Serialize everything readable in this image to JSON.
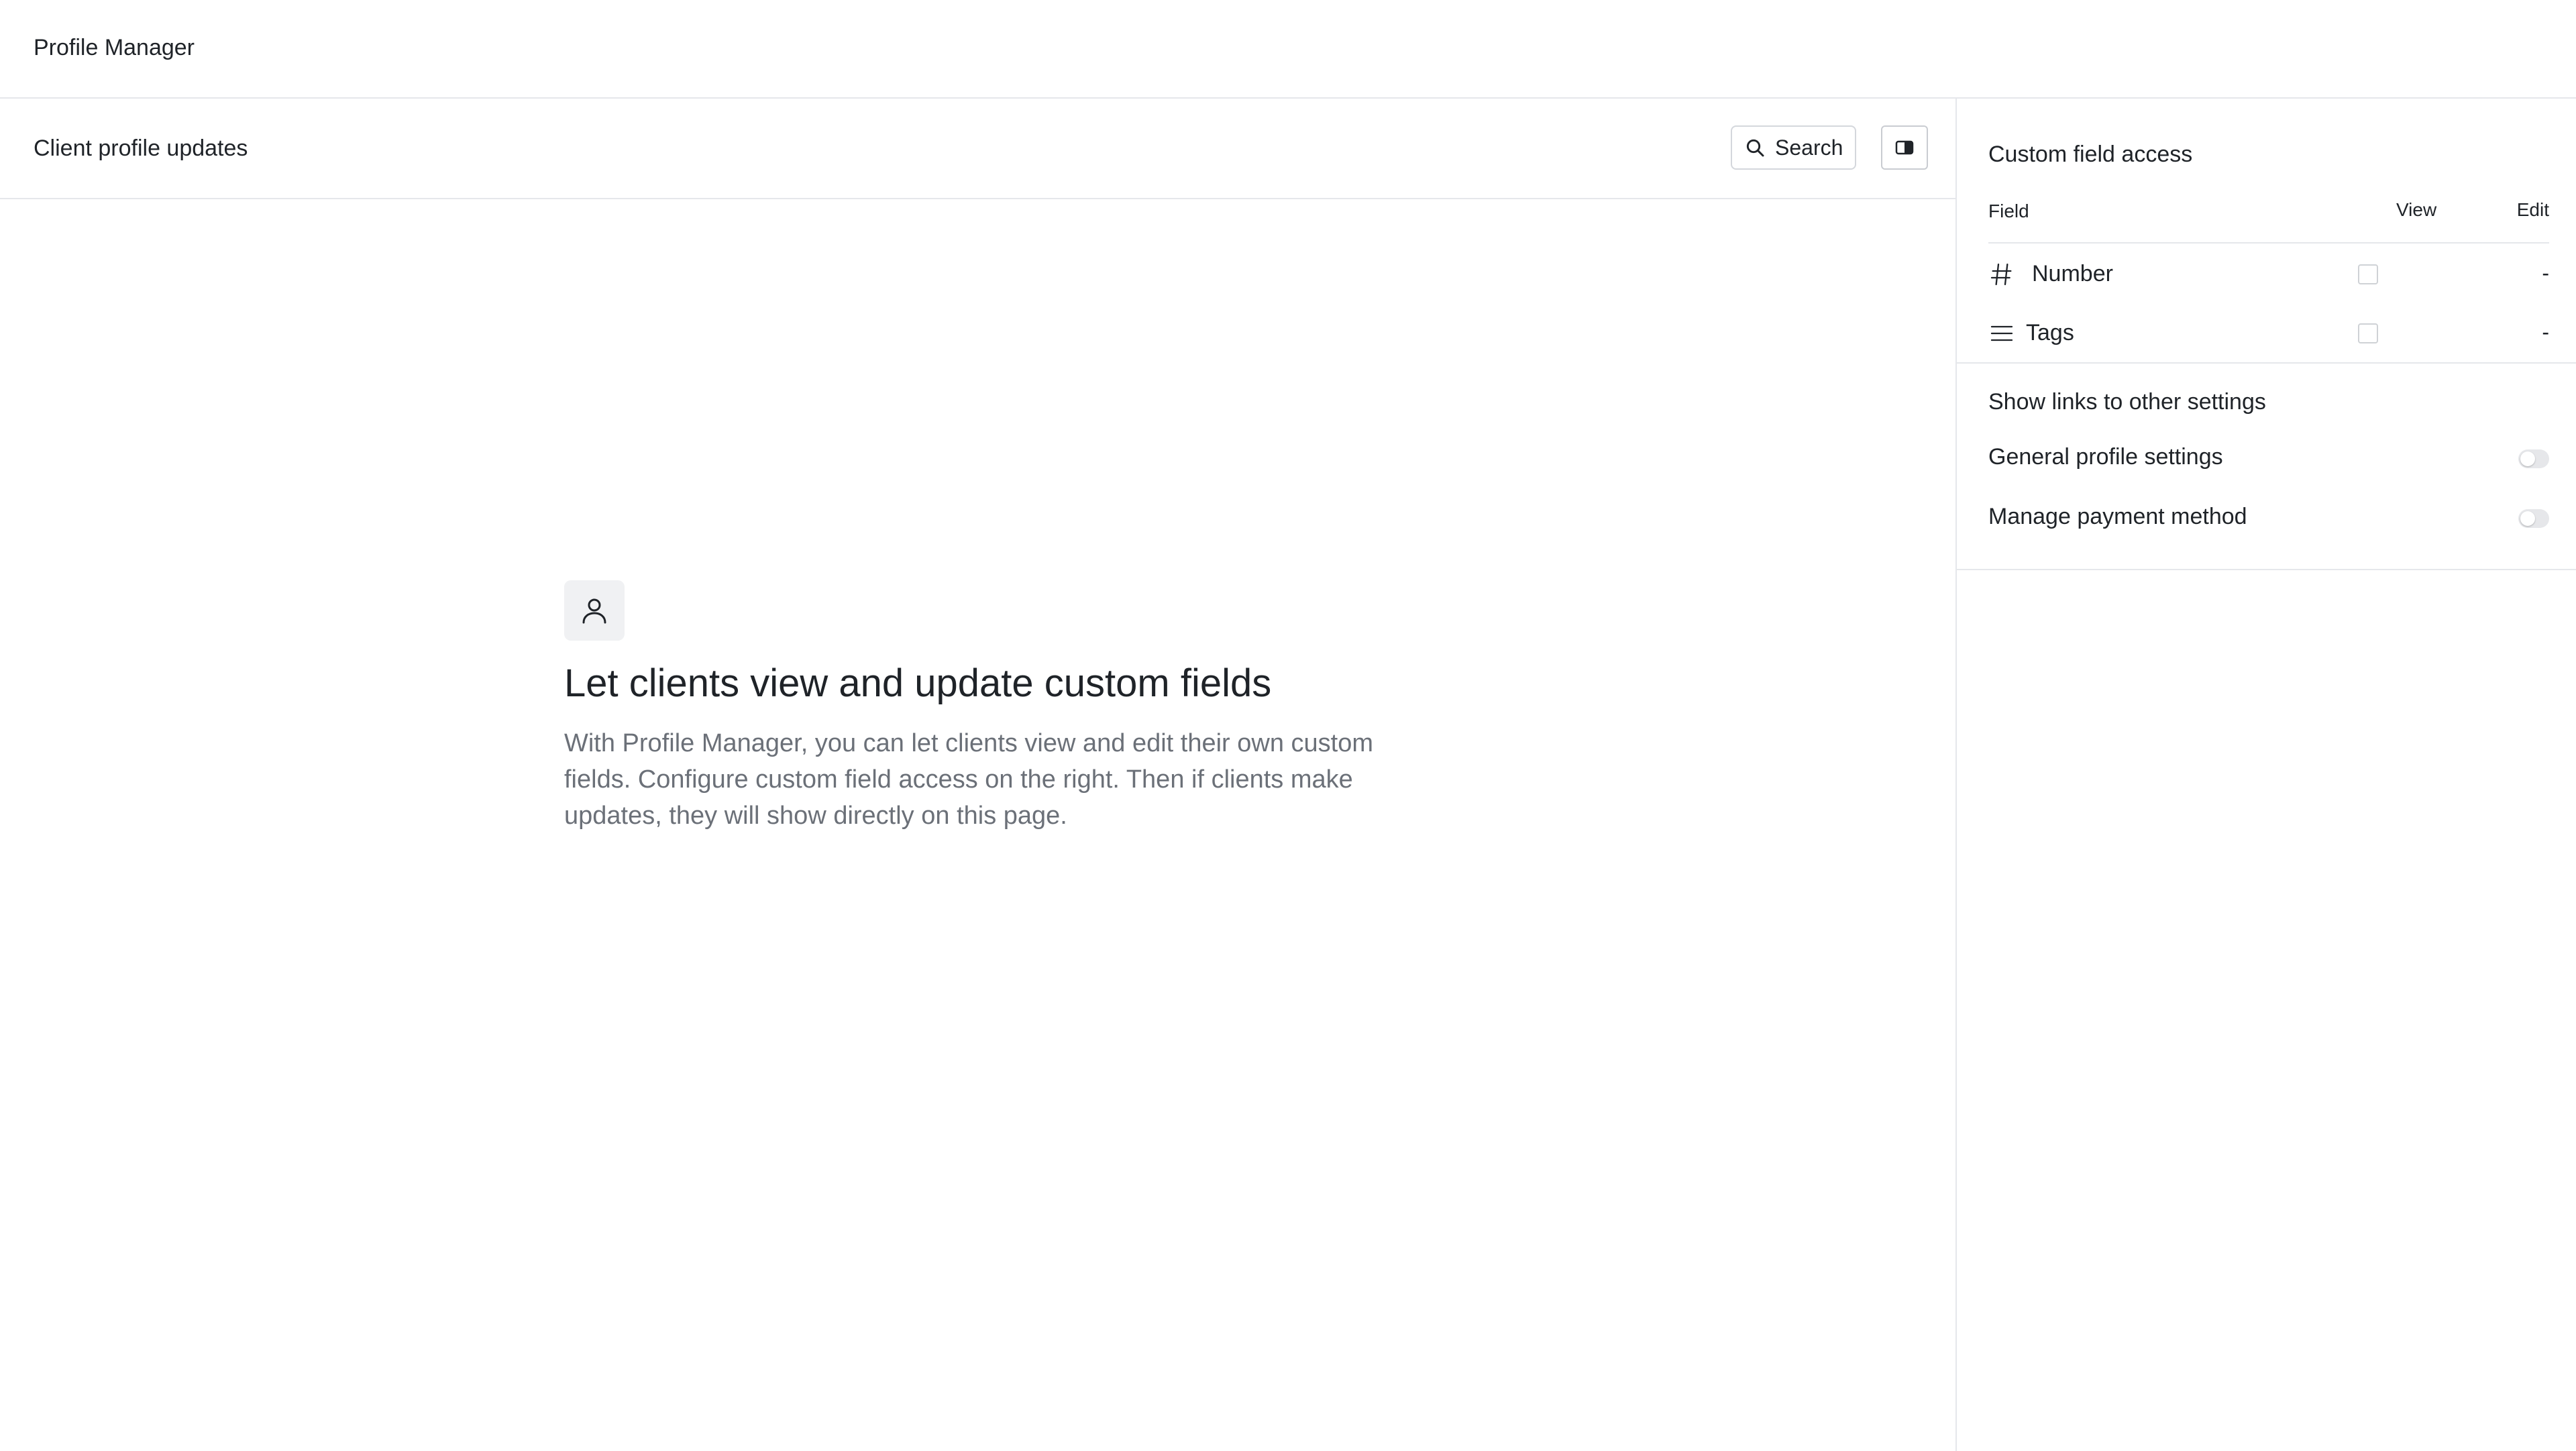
{
  "app": {
    "title": "Profile Manager"
  },
  "main": {
    "title": "Client profile updates",
    "search_label": "Search",
    "empty_state": {
      "heading": "Let clients view and update custom fields",
      "description": "With Profile Manager, you can let clients view and edit their own custom fields. Configure custom field access on the right. Then if clients make updates, they will show directly on this page."
    }
  },
  "sidebar": {
    "custom_field_access": {
      "title": "Custom field access",
      "columns": {
        "field": "Field",
        "view": "View",
        "edit": "Edit"
      },
      "rows": [
        {
          "icon": "hash-icon",
          "label": "Number",
          "view_checked": false,
          "edit": "-"
        },
        {
          "icon": "list-icon",
          "label": "Tags",
          "view_checked": false,
          "edit": "-"
        }
      ]
    },
    "links": {
      "title": "Show links to other settings",
      "items": [
        {
          "label": "General profile settings",
          "enabled": false
        },
        {
          "label": "Manage payment method",
          "enabled": false
        }
      ]
    }
  }
}
